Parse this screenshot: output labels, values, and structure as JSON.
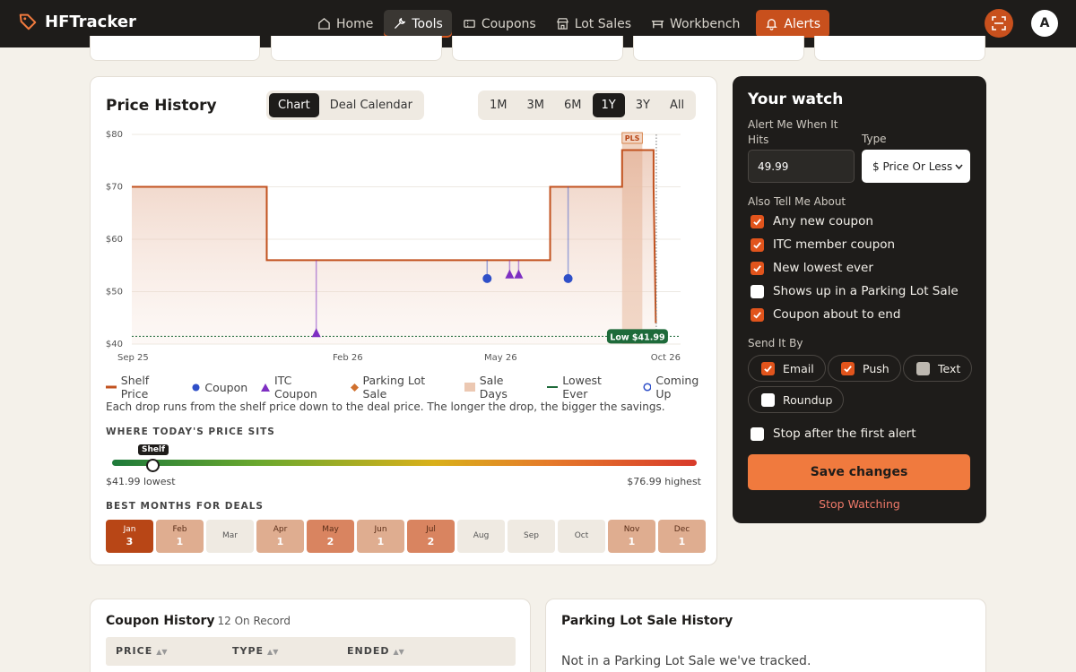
{
  "brand": {
    "name": "HFTracker"
  },
  "nav": {
    "items": [
      {
        "label": "Home",
        "icon": "home-icon"
      },
      {
        "label": "Tools",
        "icon": "wrench-icon"
      },
      {
        "label": "Coupons",
        "icon": "ticket-icon"
      },
      {
        "label": "Lot Sales",
        "icon": "store-icon"
      },
      {
        "label": "Workbench",
        "icon": "workbench-icon"
      },
      {
        "label": "Alerts",
        "icon": "bell-icon"
      }
    ],
    "active": "Tools",
    "avatar_initial": "A"
  },
  "price_history": {
    "title": "Price History",
    "view_tabs": [
      "Chart",
      "Deal Calendar"
    ],
    "active_view": "Chart",
    "ranges": [
      "1M",
      "3M",
      "6M",
      "1Y",
      "3Y",
      "All"
    ],
    "active_range": "1Y",
    "legend": [
      "Shelf Price",
      "Coupon",
      "ITC Coupon",
      "Parking Lot Sale",
      "Sale Days",
      "Lowest Ever",
      "Coming Up"
    ],
    "note": "Each drop runs from the shelf price down to the deal price. The longer the drop, the bigger the savings.",
    "gauge": {
      "label": "WHERE TODAY'S PRICE SITS",
      "tag": "Shelf",
      "low_text": "$41.99 lowest",
      "high_text": "$76.99 highest",
      "position_fraction": 0.07
    },
    "best_months": {
      "label": "BEST MONTHS FOR DEALS",
      "months": [
        {
          "name": "Jan",
          "count": "3",
          "level": 3
        },
        {
          "name": "Feb",
          "count": "1",
          "level": 1
        },
        {
          "name": "Mar",
          "count": "",
          "level": 0
        },
        {
          "name": "Apr",
          "count": "1",
          "level": 1
        },
        {
          "name": "May",
          "count": "2",
          "level": 2
        },
        {
          "name": "Jun",
          "count": "1",
          "level": 1
        },
        {
          "name": "Jul",
          "count": "2",
          "level": 2
        },
        {
          "name": "Aug",
          "count": "",
          "level": 0
        },
        {
          "name": "Sep",
          "count": "",
          "level": 0
        },
        {
          "name": "Oct",
          "count": "",
          "level": 0
        },
        {
          "name": "Nov",
          "count": "1",
          "level": 1
        },
        {
          "name": "Dec",
          "count": "1",
          "level": 1
        }
      ]
    }
  },
  "chart_data": {
    "type": "line",
    "title": "Price History",
    "x_tick_labels": [
      "Sep 25",
      "Feb 26",
      "May 26",
      "Oct 26"
    ],
    "y_tick_labels": [
      "$80",
      "$70",
      "$60",
      "$50",
      "$40"
    ],
    "ylim": [
      40,
      80
    ],
    "xlim": [
      0,
      12.2
    ],
    "x_tick_positions": [
      0,
      4.8,
      8.2,
      12.2
    ],
    "grid": true,
    "shelf_price": [
      {
        "x": 0,
        "y": 70
      },
      {
        "x": 3.0,
        "y": 70
      },
      {
        "x": 3.0,
        "y": 56
      },
      {
        "x": 9.3,
        "y": 56
      },
      {
        "x": 9.3,
        "y": 70
      },
      {
        "x": 10.9,
        "y": 70
      },
      {
        "x": 10.9,
        "y": 77
      },
      {
        "x": 11.6,
        "y": 77
      },
      {
        "x": 11.6,
        "y": 70
      },
      {
        "x": 11.65,
        "y": 44
      }
    ],
    "coupons": [
      {
        "x": 7.9,
        "y": 52.5
      },
      {
        "x": 9.7,
        "y": 52.5
      }
    ],
    "itc_coupons": [
      {
        "x": 4.1,
        "y": 42
      },
      {
        "x": 8.4,
        "y": 53.2
      },
      {
        "x": 8.6,
        "y": 53.2
      }
    ],
    "parking_lot_sale": {
      "x_start": 10.9,
      "x_end": 11.35,
      "label": "PLS"
    },
    "lowest_ever": {
      "value": 41.99,
      "label": "Low $41.99"
    },
    "coming_up_x": 11.8,
    "colors": {
      "shelf": "#c2521f",
      "coupon": "#2f4fc8",
      "itc": "#7e2fc2",
      "pls": "#d0702e",
      "sale_days": "#ecc8b2",
      "lowest": "#1e6a3a"
    }
  },
  "watch": {
    "title": "Your watch",
    "alert_label": "Alert Me When It Hits",
    "type_label": "Type",
    "alert_value": "49.99",
    "type_value": "$ Price Or Less",
    "also_label": "Also Tell Me About",
    "options": [
      {
        "label": "Any new coupon",
        "checked": true
      },
      {
        "label": "ITC member coupon",
        "checked": true
      },
      {
        "label": "New lowest ever",
        "checked": true
      },
      {
        "label": "Shows up in a Parking Lot Sale",
        "checked": false
      },
      {
        "label": "Coupon about to end",
        "checked": true
      }
    ],
    "send_label": "Send It By",
    "channels": [
      {
        "label": "Email",
        "checked": true
      },
      {
        "label": "Push",
        "checked": true
      },
      {
        "label": "Text",
        "checked": false,
        "disabled": true
      },
      {
        "label": "Roundup",
        "checked": false
      }
    ],
    "stop_after_label": "Stop after the first alert",
    "save_label": "Save changes",
    "stop_label": "Stop Watching",
    "accent": "#f07a3e"
  },
  "coupon_history": {
    "title": "Coupon History",
    "sub": "12 On Record",
    "columns": [
      "PRICE",
      "TYPE",
      "ENDED"
    ]
  },
  "lot_history": {
    "title": "Parking Lot Sale History",
    "empty": "Not in a Parking Lot Sale we've tracked."
  }
}
